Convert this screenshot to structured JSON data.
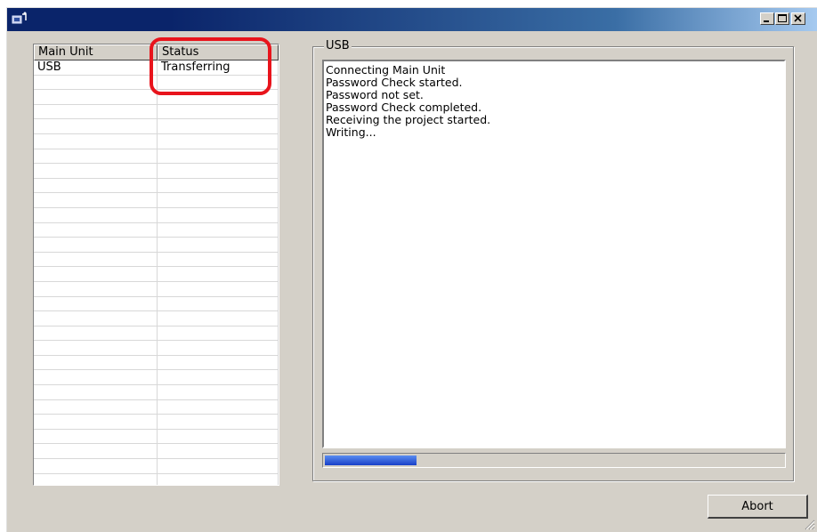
{
  "window": {
    "title": "",
    "icon": "transfer-app-icon",
    "controls": {
      "minimize_icon": "minimize-icon",
      "maximize_icon": "maximize-icon",
      "close_icon": "close-icon"
    }
  },
  "unit_list": {
    "columns": [
      "Main Unit",
      "Status"
    ],
    "rows": [
      {
        "unit": "USB",
        "status": "Transferring"
      }
    ],
    "empty_row_count": 30
  },
  "log_group": {
    "label": "USB",
    "lines": [
      "Connecting Main Unit",
      "Password Check started.",
      "Password not set.",
      "Password Check completed.",
      "Receiving the project started.",
      "Writing..."
    ]
  },
  "progress": {
    "fraction": 0.2,
    "color": "#1840c8"
  },
  "buttons": {
    "abort_label": "Abort"
  },
  "annotation": {
    "color": "#e8141c",
    "target": "status-column-header"
  },
  "colors": {
    "titlebar_start": "#0a246a",
    "titlebar_end": "#a6caf0",
    "face": "#d4d0c8"
  }
}
